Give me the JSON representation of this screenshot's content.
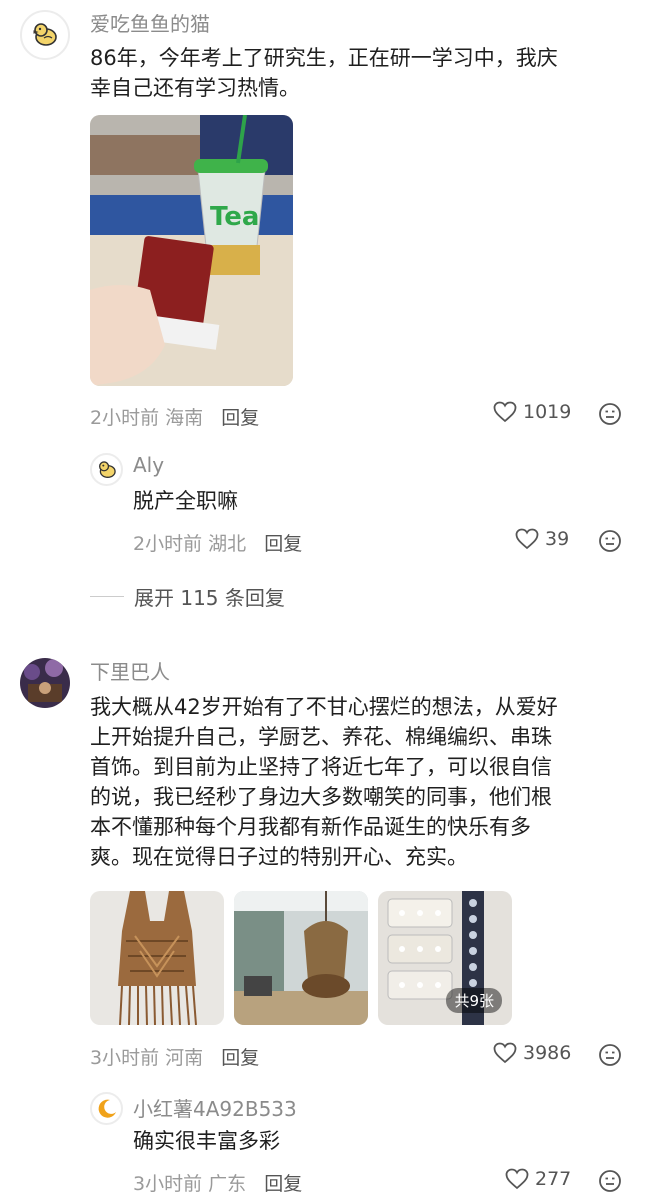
{
  "comments": [
    {
      "username": "爱吃鱼鱼的猫",
      "text_line1": "86年，今年考上了研究生，正在研一学习中，我庆",
      "text_line2": "幸自己还有学习热情。",
      "time": "2小时前",
      "location": "海南",
      "reply_label": "回复",
      "likes": "1019",
      "replies": [
        {
          "username": "Aly",
          "text": "脱产全职嘛",
          "time": "2小时前",
          "location": "湖北",
          "reply_label": "回复",
          "likes": "39"
        }
      ],
      "expand_label": "展开 115 条回复"
    },
    {
      "username": "下里巴人",
      "lines": [
        "我大概从42岁开始有了不甘心摆烂的想法，从爱好",
        "上开始提升自己，学厨艺、养花、棉绳编织、串珠",
        "首饰。到目前为止坚持了将近七年了，可以很自信",
        "的说，我已经秒了身边大多数嘲笑的同事，他们根",
        "本不懂那种每个月我都有新作品诞生的快乐有多",
        "爽。现在觉得日子过的特别开心、充实。"
      ],
      "image_count_badge": "共9张",
      "time": "3小时前",
      "location": "河南",
      "reply_label": "回复",
      "likes": "3986",
      "replies": [
        {
          "username": "小红薯4A92B533",
          "text": "确实很丰富多彩",
          "time": "3小时前",
          "location": "广东",
          "reply_label": "回复",
          "likes": "277"
        }
      ]
    }
  ]
}
